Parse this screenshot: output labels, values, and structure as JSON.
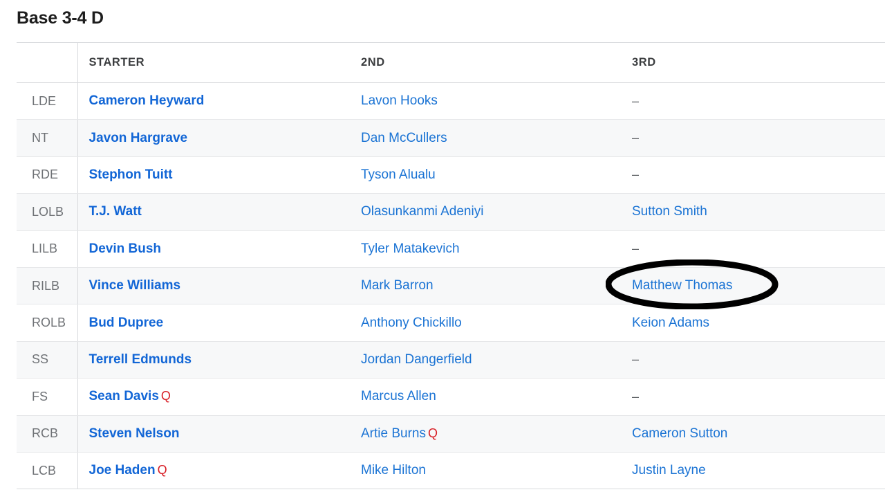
{
  "page": {
    "title": "Base 3-4 D"
  },
  "table": {
    "columns": [
      {
        "key": "position",
        "label": ""
      },
      {
        "key": "starter",
        "label": "STARTER"
      },
      {
        "key": "second",
        "label": "2ND"
      },
      {
        "key": "third",
        "label": "3RD"
      }
    ],
    "empty_value": "–",
    "injury_designation": "Q",
    "rows": [
      {
        "position": "LDE",
        "starter": {
          "name": "Cameron Heyward",
          "injury": ""
        },
        "second": {
          "name": "Lavon Hooks",
          "injury": ""
        },
        "third": {
          "name": "–",
          "injury": ""
        }
      },
      {
        "position": "NT",
        "starter": {
          "name": "Javon Hargrave",
          "injury": ""
        },
        "second": {
          "name": "Dan McCullers",
          "injury": ""
        },
        "third": {
          "name": "–",
          "injury": ""
        }
      },
      {
        "position": "RDE",
        "starter": {
          "name": "Stephon Tuitt",
          "injury": ""
        },
        "second": {
          "name": "Tyson Alualu",
          "injury": ""
        },
        "third": {
          "name": "–",
          "injury": ""
        }
      },
      {
        "position": "LOLB",
        "starter": {
          "name": "T.J. Watt",
          "injury": ""
        },
        "second": {
          "name": "Olasunkanmi Adeniyi",
          "injury": ""
        },
        "third": {
          "name": "Sutton Smith",
          "injury": ""
        }
      },
      {
        "position": "LILB",
        "starter": {
          "name": "Devin Bush",
          "injury": ""
        },
        "second": {
          "name": "Tyler Matakevich",
          "injury": ""
        },
        "third": {
          "name": "–",
          "injury": ""
        }
      },
      {
        "position": "RILB",
        "starter": {
          "name": "Vince Williams",
          "injury": ""
        },
        "second": {
          "name": "Mark Barron",
          "injury": ""
        },
        "third": {
          "name": "Matthew Thomas",
          "injury": ""
        }
      },
      {
        "position": "ROLB",
        "starter": {
          "name": "Bud Dupree",
          "injury": ""
        },
        "second": {
          "name": "Anthony Chickillo",
          "injury": ""
        },
        "third": {
          "name": "Keion Adams",
          "injury": ""
        }
      },
      {
        "position": "SS",
        "starter": {
          "name": "Terrell Edmunds",
          "injury": ""
        },
        "second": {
          "name": "Jordan Dangerfield",
          "injury": ""
        },
        "third": {
          "name": "–",
          "injury": ""
        }
      },
      {
        "position": "FS",
        "starter": {
          "name": "Sean Davis",
          "injury": "Q"
        },
        "second": {
          "name": "Marcus Allen",
          "injury": ""
        },
        "third": {
          "name": "–",
          "injury": ""
        }
      },
      {
        "position": "RCB",
        "starter": {
          "name": "Steven Nelson",
          "injury": ""
        },
        "second": {
          "name": "Artie Burns",
          "injury": "Q"
        },
        "third": {
          "name": "Cameron Sutton",
          "injury": ""
        }
      },
      {
        "position": "LCB",
        "starter": {
          "name": "Joe Haden",
          "injury": "Q"
        },
        "second": {
          "name": "Mike Hilton",
          "injury": ""
        },
        "third": {
          "name": "Justin Layne",
          "injury": ""
        }
      }
    ]
  },
  "annotation": {
    "shape": "ellipse",
    "target_text": "Matthew Thomas",
    "color": "#000000"
  },
  "colors": {
    "link_blue": "#1668dc",
    "injury_red": "#d81f26",
    "position_gray": "#6f7276",
    "header_gray": "#3b3d3f",
    "row_stripe": "#f7f8f9",
    "border": "#d8dadd"
  }
}
